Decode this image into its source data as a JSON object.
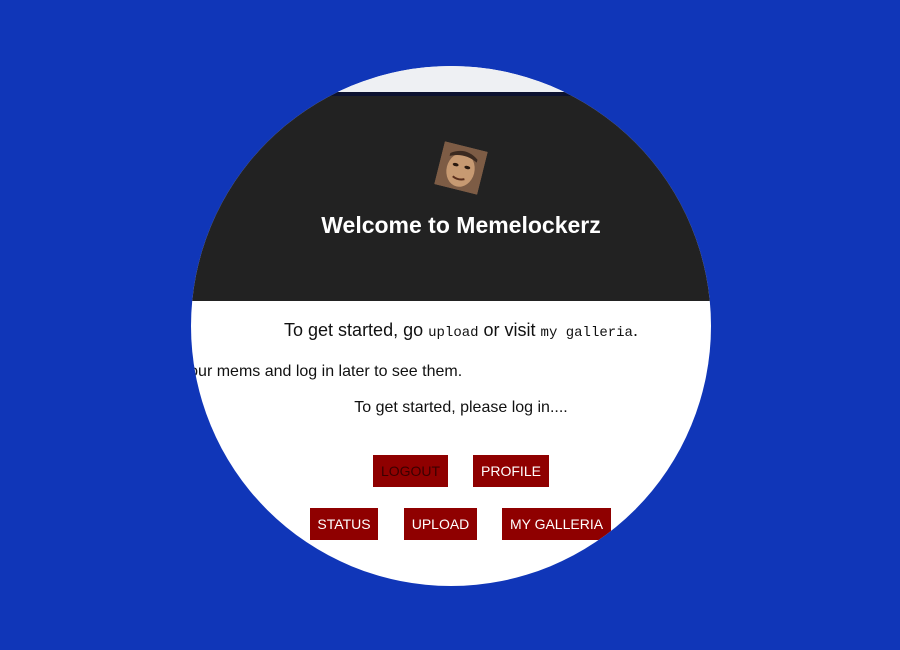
{
  "header": {
    "title": "Welcome to Memelockerz",
    "logo_icon": "face-avatar-icon"
  },
  "content": {
    "intro_prefix": "To get started, go ",
    "intro_upload": "upload",
    "intro_middle": " or visit ",
    "intro_gallery": "my galleria",
    "intro_suffix": ".",
    "description": "Memelockerz is a place where you can store your mems and log in later to see them.",
    "login_prompt": "To get started, please log in...."
  },
  "buttons": {
    "logout": "LOGOUT",
    "profile": "PROFILE",
    "status": "STATUS",
    "upload": "UPLOAD",
    "gallery": "MY GALLERIA"
  },
  "colors": {
    "page_background": "#1036b8",
    "header_background": "#222222",
    "button_background": "#8f0000"
  }
}
